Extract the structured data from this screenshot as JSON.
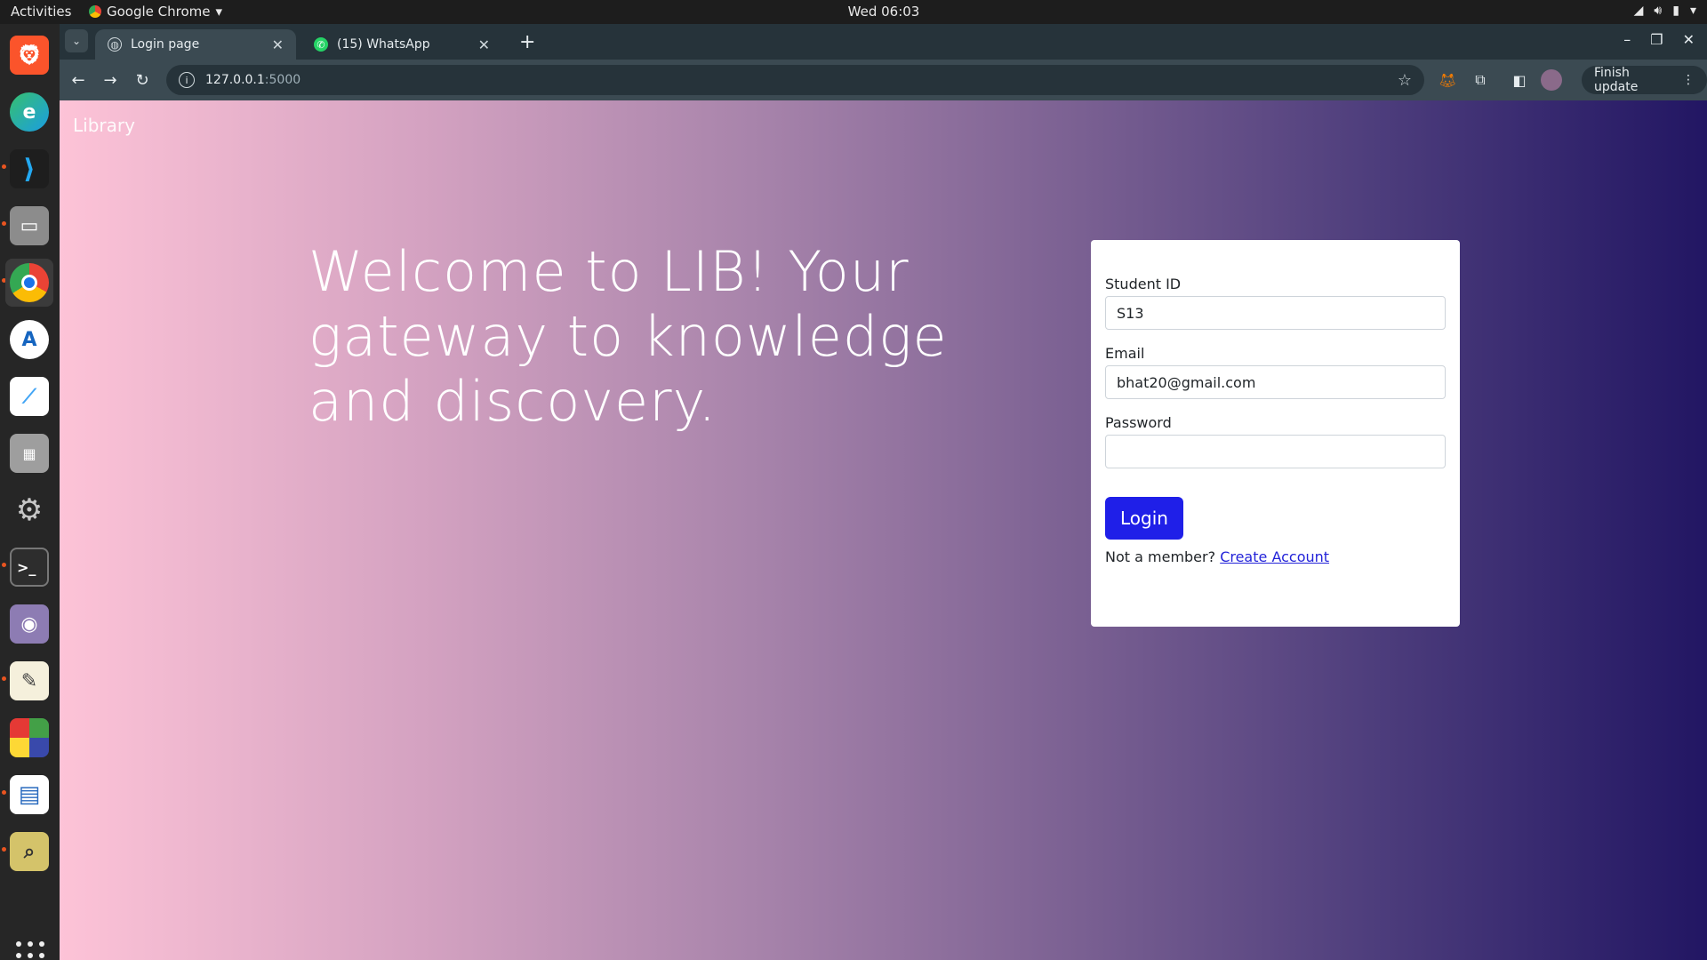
{
  "topbar": {
    "activities": "Activities",
    "app_name": "Google Chrome",
    "clock": "Wed 06:03"
  },
  "dock": {
    "items": [
      {
        "name": "brave-browser-icon",
        "color": "#fb542b"
      },
      {
        "name": "edge-browser-icon",
        "color": "#1b9de2"
      },
      {
        "name": "vscode-icon",
        "color": "#23a9f2"
      },
      {
        "name": "file-manager-icon",
        "color": "#8c8c8c"
      },
      {
        "name": "chrome-icon",
        "color": "#1a73e8"
      },
      {
        "name": "android-studio-icon",
        "color": "#3ddc84"
      },
      {
        "name": "flutter-icon",
        "color": "#42a5f5"
      },
      {
        "name": "calculator-icon",
        "color": "#9e9e9e"
      },
      {
        "name": "settings-tools-icon",
        "color": "#b0b0b0"
      },
      {
        "name": "terminal-icon",
        "color": "#2d2d2d"
      },
      {
        "name": "screenshot-icon",
        "color": "#8d7cb3"
      },
      {
        "name": "text-editor-icon",
        "color": "#f5f0dc"
      },
      {
        "name": "windows-apps-icon",
        "color": "#e53935"
      },
      {
        "name": "writer-icon",
        "color": "#2a6bbf"
      },
      {
        "name": "image-viewer-icon",
        "color": "#d4c36a"
      }
    ]
  },
  "browser": {
    "tabs": [
      {
        "label": "Login page",
        "active": true
      },
      {
        "label": "(15) WhatsApp",
        "active": false
      }
    ],
    "url_host": "127.0.0.1",
    "url_port": ":5000",
    "finish_update": "Finish update"
  },
  "page": {
    "brand": "Library",
    "hero": "Welcome to LIB! Your gateway to knowledge and discovery.",
    "form": {
      "student_id_label": "Student ID",
      "student_id_value": "S13",
      "email_label": "Email",
      "email_value": "bhat20@gmail.com",
      "password_label": "Password",
      "password_value": "",
      "login_label": "Login",
      "member_text": "Not a member?",
      "create_account": "Create Account"
    }
  }
}
